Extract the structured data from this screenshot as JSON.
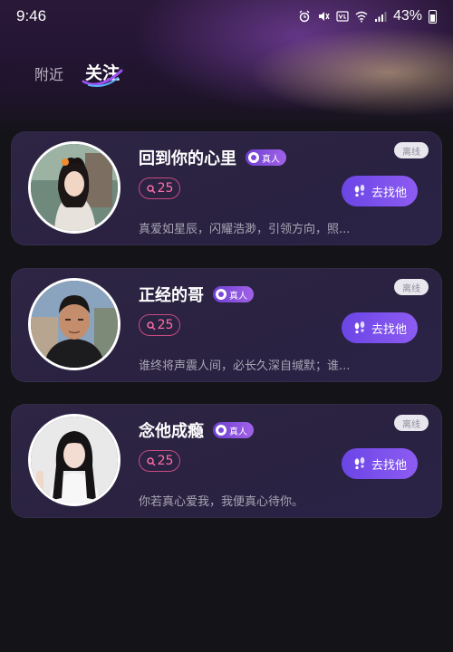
{
  "status_bar": {
    "time": "9:46",
    "battery": "43%",
    "icons": [
      "alarm-icon",
      "mute-icon",
      "volte-icon",
      "wifi-icon",
      "signal-icon",
      "battery-icon"
    ]
  },
  "tabs": [
    {
      "label": "附近",
      "active": false
    },
    {
      "label": "关注",
      "active": true
    }
  ],
  "users": [
    {
      "name": "回到你的心里",
      "badge": "真人",
      "age": "25",
      "status": "离线",
      "button": "去找他",
      "bio": "真爱如星辰，闪耀浩渺，引领方向，照..."
    },
    {
      "name": "正经的哥",
      "badge": "真人",
      "age": "25",
      "status": "离线",
      "button": "去找他",
      "bio": "谁终将声震人间，必长久深自缄默；谁..."
    },
    {
      "name": "念他成瘾",
      "badge": "真人",
      "age": "25",
      "status": "离线",
      "button": "去找他",
      "bio": "你若真心爱我，我便真心待你。"
    }
  ],
  "colors": {
    "accent": "#7b4fee",
    "age_pink": "#ff6fa8",
    "background": "#141318",
    "card": "#2c2443"
  }
}
